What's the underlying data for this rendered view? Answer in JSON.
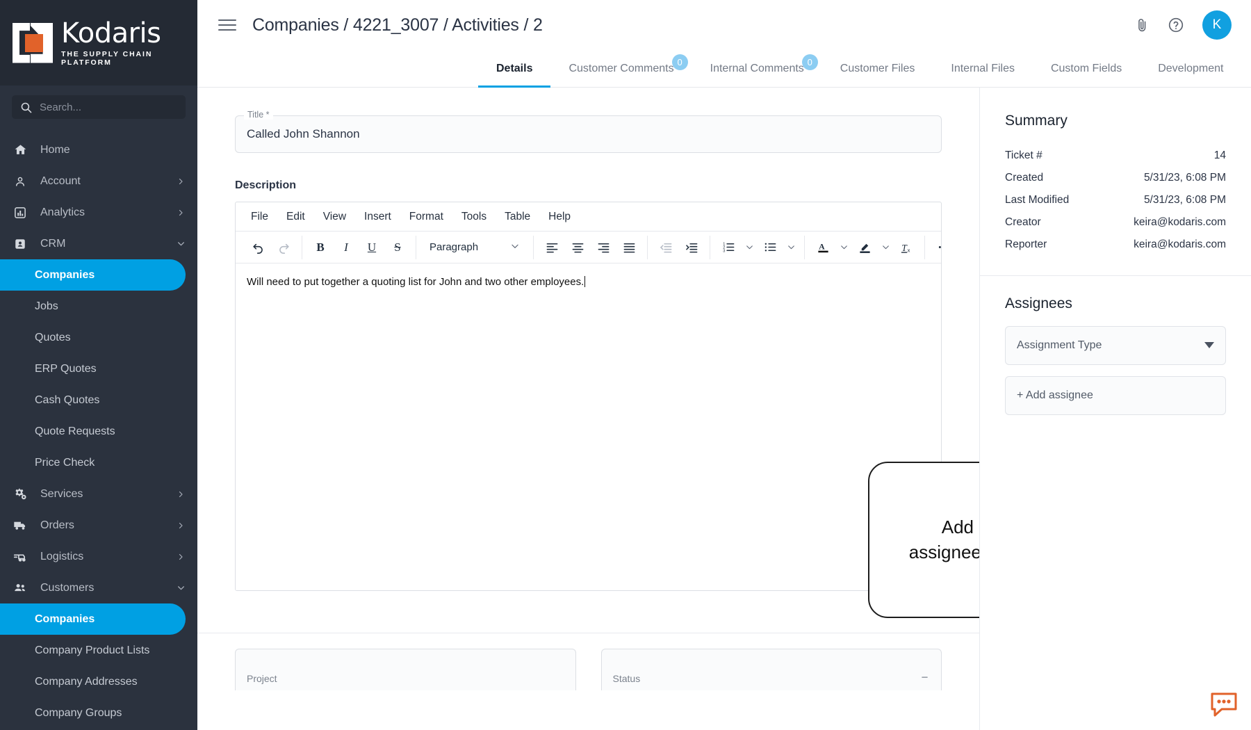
{
  "brand": {
    "name": "Kodaris",
    "tagline": "THE SUPPLY CHAIN PLATFORM",
    "accent_orange": "#e1622a",
    "accent_blue": "#00a0e3",
    "sidebar_bg": "#2b323e"
  },
  "sidebar": {
    "search": {
      "placeholder": "Search...",
      "value": "",
      "icon": "search-icon"
    },
    "items": [
      {
        "label": "Home",
        "icon": "home-icon",
        "level": "top",
        "chevron": "",
        "active": false
      },
      {
        "label": "Account",
        "icon": "person-icon",
        "level": "top",
        "chevron": "right",
        "active": false
      },
      {
        "label": "Analytics",
        "icon": "chart-icon",
        "level": "top",
        "chevron": "right",
        "active": false
      },
      {
        "label": "CRM",
        "icon": "contact-card-icon",
        "level": "top",
        "chevron": "down",
        "active": false
      },
      {
        "label": "Companies",
        "icon": "",
        "level": "sub",
        "chevron": "",
        "active": true
      },
      {
        "label": "Jobs",
        "icon": "",
        "level": "sub",
        "chevron": "",
        "active": false
      },
      {
        "label": "Quotes",
        "icon": "",
        "level": "sub",
        "chevron": "",
        "active": false
      },
      {
        "label": "ERP Quotes",
        "icon": "",
        "level": "sub",
        "chevron": "",
        "active": false
      },
      {
        "label": "Cash Quotes",
        "icon": "",
        "level": "sub",
        "chevron": "",
        "active": false
      },
      {
        "label": "Quote Requests",
        "icon": "",
        "level": "sub",
        "chevron": "",
        "active": false
      },
      {
        "label": "Price Check",
        "icon": "",
        "level": "sub",
        "chevron": "",
        "active": false
      },
      {
        "label": "Services",
        "icon": "gears-icon",
        "level": "top",
        "chevron": "right",
        "active": false
      },
      {
        "label": "Orders",
        "icon": "truck-icon",
        "level": "top",
        "chevron": "right",
        "active": false
      },
      {
        "label": "Logistics",
        "icon": "delivery-icon",
        "level": "top",
        "chevron": "right",
        "active": false
      },
      {
        "label": "Customers",
        "icon": "people-icon",
        "level": "top",
        "chevron": "down",
        "active": false
      },
      {
        "label": "Companies",
        "icon": "",
        "level": "sub",
        "chevron": "",
        "active": true
      },
      {
        "label": "Company Product Lists",
        "icon": "",
        "level": "sub",
        "chevron": "",
        "active": false
      },
      {
        "label": "Company Addresses",
        "icon": "",
        "level": "sub",
        "chevron": "",
        "active": false
      },
      {
        "label": "Company Groups",
        "icon": "",
        "level": "sub",
        "chevron": "",
        "active": false
      }
    ]
  },
  "topbar": {
    "breadcrumb": "Companies / 4221_3007 / Activities / 2",
    "menu_icon": "hamburger-icon",
    "attach_icon": "paperclip-icon",
    "help_icon": "help-circle-icon",
    "avatar_initial": "K"
  },
  "tabs": [
    {
      "label": "Details",
      "badge": "",
      "active": true
    },
    {
      "label": "Customer Comments",
      "badge": "0",
      "active": false
    },
    {
      "label": "Internal Comments",
      "badge": "0",
      "active": false
    },
    {
      "label": "Customer Files",
      "badge": "",
      "active": false
    },
    {
      "label": "Internal Files",
      "badge": "",
      "active": false
    },
    {
      "label": "Custom Fields",
      "badge": "",
      "active": false
    },
    {
      "label": "Development",
      "badge": "",
      "active": false
    }
  ],
  "form": {
    "title_legend": "Title *",
    "title_value": "Called John Shannon",
    "description_label": "Description",
    "bottom_fields": [
      {
        "label": "Project",
        "has_arrow": false
      },
      {
        "label": "Status",
        "has_arrow": true
      }
    ]
  },
  "editor": {
    "menus": [
      "File",
      "Edit",
      "View",
      "Insert",
      "Format",
      "Tools",
      "Table",
      "Help"
    ],
    "format_select": "Paragraph",
    "body_text": "Will need to put together a quoting list for John and two other employees.",
    "toolbar_groups": [
      {
        "buttons": [
          {
            "name": "undo-icon",
            "label": "undo",
            "disabled": false
          },
          {
            "name": "redo-icon",
            "label": "redo",
            "disabled": true
          }
        ]
      },
      {
        "buttons": [
          {
            "name": "bold-icon",
            "label": "B",
            "disabled": false
          },
          {
            "name": "italic-icon",
            "label": "I",
            "disabled": false
          },
          {
            "name": "underline-icon",
            "label": "U",
            "disabled": false
          },
          {
            "name": "strikethrough-icon",
            "label": "S",
            "disabled": false
          }
        ]
      },
      {
        "buttons": [
          {
            "name": "align-left-icon",
            "label": "align left",
            "disabled": false
          },
          {
            "name": "align-center-icon",
            "label": "align center",
            "disabled": false
          },
          {
            "name": "align-right-icon",
            "label": "align right",
            "disabled": false
          },
          {
            "name": "align-justify-icon",
            "label": "justify",
            "disabled": false
          }
        ]
      },
      {
        "buttons": [
          {
            "name": "outdent-icon",
            "label": "outdent",
            "disabled": true
          },
          {
            "name": "indent-icon",
            "label": "indent",
            "disabled": false
          }
        ]
      },
      {
        "buttons": [
          {
            "name": "numbered-list-icon",
            "label": "numbered list",
            "disabled": false
          },
          {
            "name": "bulleted-list-icon",
            "label": "bulleted list",
            "disabled": false
          }
        ]
      },
      {
        "buttons": [
          {
            "name": "text-color-icon",
            "label": "text color",
            "disabled": false
          },
          {
            "name": "highlight-color-icon",
            "label": "highlight",
            "disabled": false
          },
          {
            "name": "clear-formatting-icon",
            "label": "clear formatting",
            "disabled": false
          }
        ]
      },
      {
        "buttons": [
          {
            "name": "more-options-icon",
            "label": "more",
            "disabled": false
          }
        ]
      }
    ]
  },
  "annotation": {
    "line1": "Add any notes,",
    "line2": "assignees, etc needed."
  },
  "summary": {
    "title": "Summary",
    "rows": [
      {
        "key": "Ticket #",
        "value": "14"
      },
      {
        "key": "Created",
        "value": "5/31/23, 6:08 PM"
      },
      {
        "key": "Last Modified",
        "value": "5/31/23, 6:08 PM"
      },
      {
        "key": "Creator",
        "value": "keira@kodaris.com"
      },
      {
        "key": "Reporter",
        "value": "keira@kodaris.com"
      }
    ]
  },
  "assignees": {
    "title": "Assignees",
    "type_placeholder": "Assignment Type",
    "add_label": "+ Add assignee"
  }
}
